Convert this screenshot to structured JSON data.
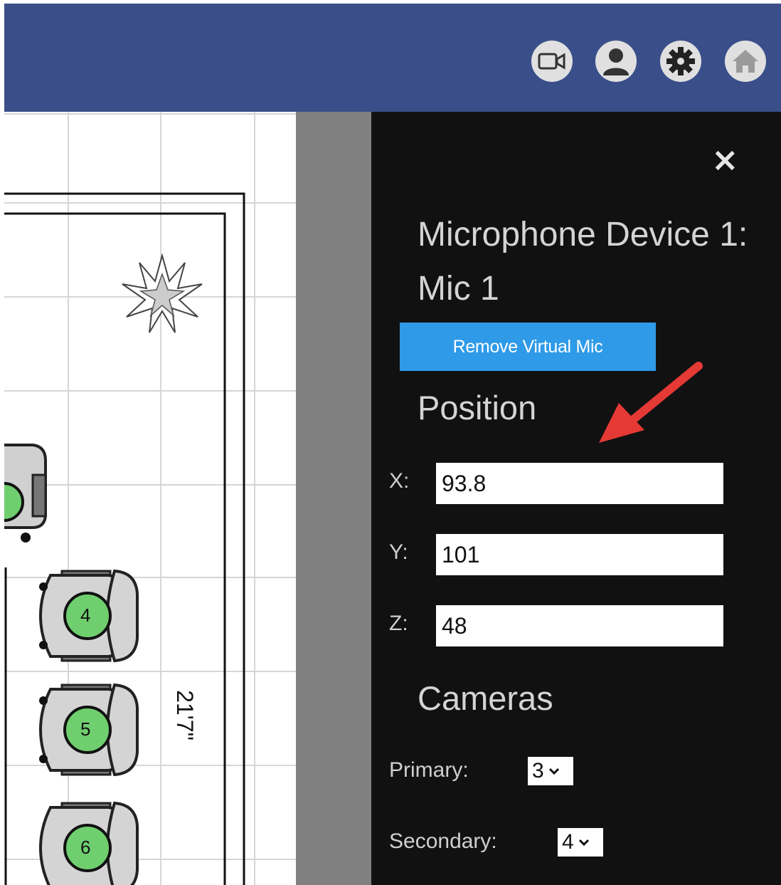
{
  "header": {
    "icons": [
      "video-camera-icon",
      "user-icon",
      "gear-icon",
      "home-icon"
    ],
    "color": "#3a4f8a"
  },
  "floorplan": {
    "dimension_label": "21'7\"",
    "seats": [
      {
        "number": "4"
      },
      {
        "number": "5"
      },
      {
        "number": "6"
      }
    ],
    "seat_color": "#6fcf6f"
  },
  "panel": {
    "close_label": "×",
    "title": "Microphone Device 1: Mic 1",
    "remove_button": "Remove Virtual Mic",
    "position_heading": "Position",
    "x_label": "X:",
    "x_value": "93.8",
    "y_label": "Y:",
    "y_value": "101",
    "z_label": "Z:",
    "z_value": "48",
    "cameras_heading": "Cameras",
    "primary_label": "Primary:",
    "primary_value": "3",
    "secondary_label": "Secondary:",
    "secondary_value": "4",
    "accent": "#2e9ae8"
  }
}
